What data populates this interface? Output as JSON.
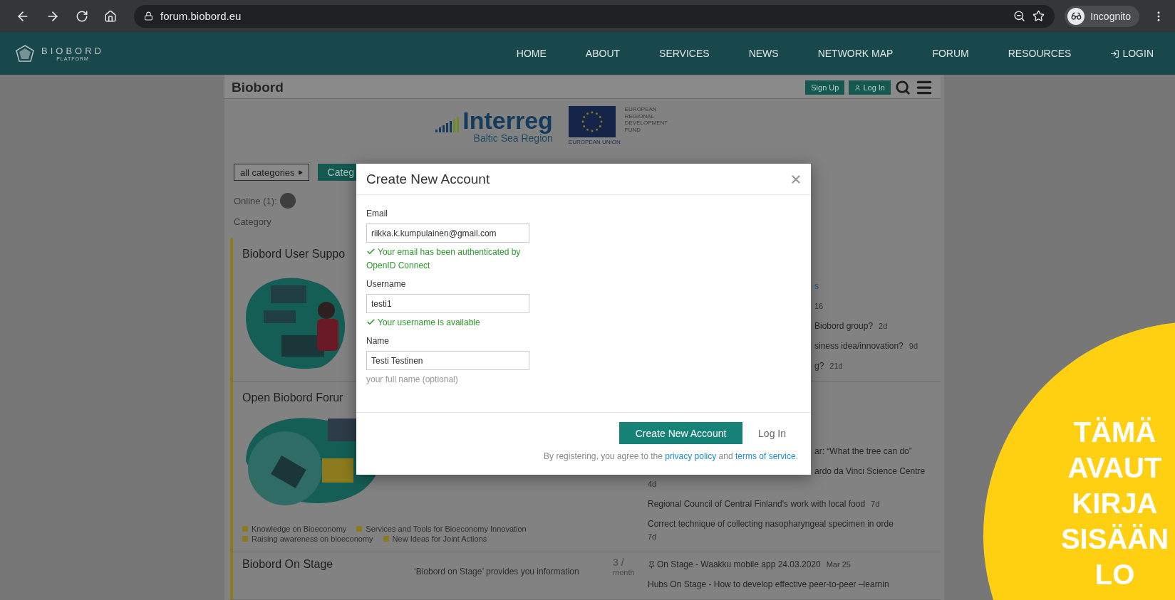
{
  "browser": {
    "url": "forum.biobord.eu",
    "profile": "Incognito"
  },
  "site_nav": {
    "logo": {
      "name": "BIOBORD",
      "tagline": "PLATFORM"
    },
    "items": [
      {
        "label": "HOME",
        "kind": "link"
      },
      {
        "label": "ABOUT",
        "kind": "link"
      },
      {
        "label": "SERVICES",
        "kind": "link"
      },
      {
        "label": "NEWS",
        "kind": "link"
      },
      {
        "label": "NETWORK MAP",
        "kind": "link"
      },
      {
        "label": "FORUM",
        "kind": "link"
      },
      {
        "label": "RESOURCES",
        "kind": "link"
      },
      {
        "label": "LOGIN",
        "kind": "login"
      }
    ]
  },
  "forum_header": {
    "title": "Biobord",
    "buttons": [
      {
        "label": "Sign Up",
        "kind": "signup"
      },
      {
        "label": "Log In",
        "kind": "login"
      }
    ]
  },
  "sponsors": {
    "interreg": {
      "name": "Interreg",
      "region": "Baltic Sea Region"
    },
    "eu": {
      "fund": "EUROPEAN REGIONAL DEVELOPMENT FUND",
      "caption": "EUROPEAN UNION"
    }
  },
  "filters": {
    "dropdown": "all categories",
    "button": "Categ"
  },
  "online": {
    "label": "Online (1):"
  },
  "category_heading": "Category",
  "categories": [
    {
      "title": "Biobord User Suppo",
      "kind": "support",
      "topics": [
        {
          "kind": "clipped-link",
          "title": "s",
          "pinned": false
        },
        {
          "kind": "clipped",
          "age": "16",
          "pinned": false
        },
        {
          "kind": "clipped",
          "title": "Biobord group?",
          "age": "2d",
          "pinned": false
        },
        {
          "kind": "clipped",
          "title": "siness idea/innovation?",
          "age": "9d",
          "pinned": false
        },
        {
          "kind": "clipped",
          "title": "g?",
          "age": "21d",
          "pinned": false
        }
      ]
    },
    {
      "title": "Open Biobord Forur",
      "kind": "forum",
      "tags": [
        "Knowledge on Bioeconomy",
        "Services and Tools for Bioeconomy Innovation",
        "Raising awareness on bioeconomy",
        "New Ideas for Joint Actions"
      ],
      "topics": [
        {
          "kind": "clipped",
          "title": "ar: “What the tree can do”",
          "pinned": false
        },
        {
          "kind": "clipped-stacked",
          "title": "ardo da Vinci Science Centre",
          "age": "4d",
          "pinned": false
        },
        {
          "kind": "inline",
          "title": "Regional Council of Central Finland's work with local food",
          "age": "7d",
          "pinned": false
        },
        {
          "kind": "stacked",
          "title": "Correct technique of collecting nasopharyngeal specimen in orde",
          "age": "7d",
          "pinned": false
        }
      ]
    },
    {
      "title": "Biobord On Stage",
      "description": "‘Biobord on Stage’ provides you information",
      "stats": [
        "3 /",
        "month"
      ],
      "topics": [
        {
          "kind": "inline",
          "title": "On Stage - Waakku mobile app 24.03.2020",
          "age": "Mar 25",
          "pinned": true
        },
        {
          "kind": "inline",
          "title": "Hubs On Stage - How to develop effective peer-to-peer –learnin",
          "pinned": false
        }
      ]
    }
  ],
  "modal": {
    "title": "Create New Account",
    "fields": [
      {
        "label": "Email",
        "value": "riikka.k.kumpulainen@gmail.com",
        "note": {
          "kind": "success",
          "text": "Your email has been authenticated by OpenID Connect"
        }
      },
      {
        "label": "Username",
        "value": "testi1",
        "note": {
          "kind": "success",
          "text": "Your username is available"
        }
      },
      {
        "label": "Name",
        "value": "Testi Testinen",
        "note": {
          "kind": "hint",
          "text": "your full name (optional)"
        }
      }
    ],
    "submit": "Create New Account",
    "alt_link": "Log In",
    "terms": {
      "before": "By registering, you agree to the",
      "privacy": "privacy policy",
      "middle": "and",
      "service": "terms of service",
      "after": "."
    }
  },
  "callout": {
    "lines": [
      "TÄMÄ",
      "AVAUT",
      "KIRJA",
      "SISÄÄN",
      "LO"
    ]
  }
}
